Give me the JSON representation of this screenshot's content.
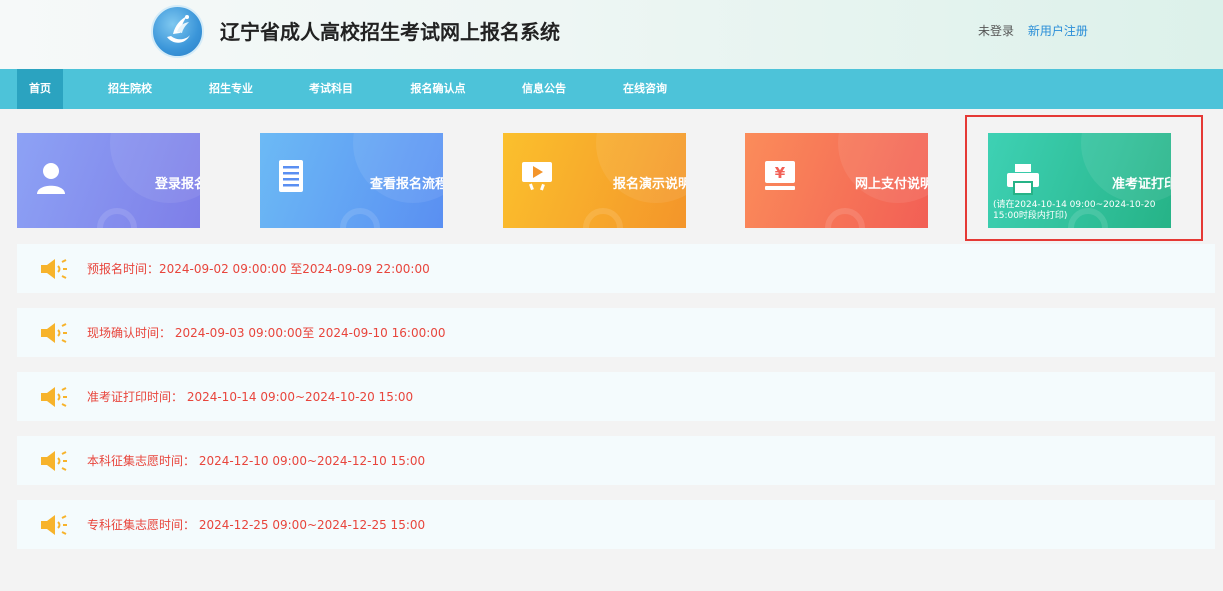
{
  "header": {
    "title": "辽宁省成人高校招生考试网上报名系统",
    "not_logged_in": "未登录",
    "register": "新用户注册"
  },
  "nav": [
    {
      "label": "首页",
      "active": true
    },
    {
      "label": "招生院校"
    },
    {
      "label": "招生专业"
    },
    {
      "label": "考试科目"
    },
    {
      "label": "报名确认点"
    },
    {
      "label": "信息公告"
    },
    {
      "label": "在线咨询"
    }
  ],
  "cards": [
    {
      "label": "登录报名",
      "icon": "user-icon"
    },
    {
      "label": "查看报名流程",
      "icon": "document-icon"
    },
    {
      "label": "报名演示说明",
      "icon": "play-icon"
    },
    {
      "label": "网上支付说明",
      "icon": "payment-icon"
    },
    {
      "label": "准考证打印",
      "icon": "printer-icon",
      "sub": "(请在2024-10-14 09:00~2024-10-20 15:00时段内打印)"
    }
  ],
  "notices": [
    {
      "text": "预报名时间：2024-09-02 09:00:00 至2024-09-09 22:00:00"
    },
    {
      "text": "现场确认时间： 2024-09-03 09:00:00至 2024-09-10 16:00:00"
    },
    {
      "text": "准考证打印时间： 2024-10-14 09:00~2024-10-20 15:00"
    },
    {
      "text": "本科征集志愿时间： 2024-12-10 09:00~2024-12-10 15:00"
    },
    {
      "text": "专科征集志愿时间： 2024-12-25 09:00~2024-12-25 15:00"
    }
  ],
  "colors": {
    "nav": "#4dc3d9",
    "nav_active": "#2ba3c0",
    "notice_text": "#e8453c",
    "highlight": "#e53935"
  }
}
